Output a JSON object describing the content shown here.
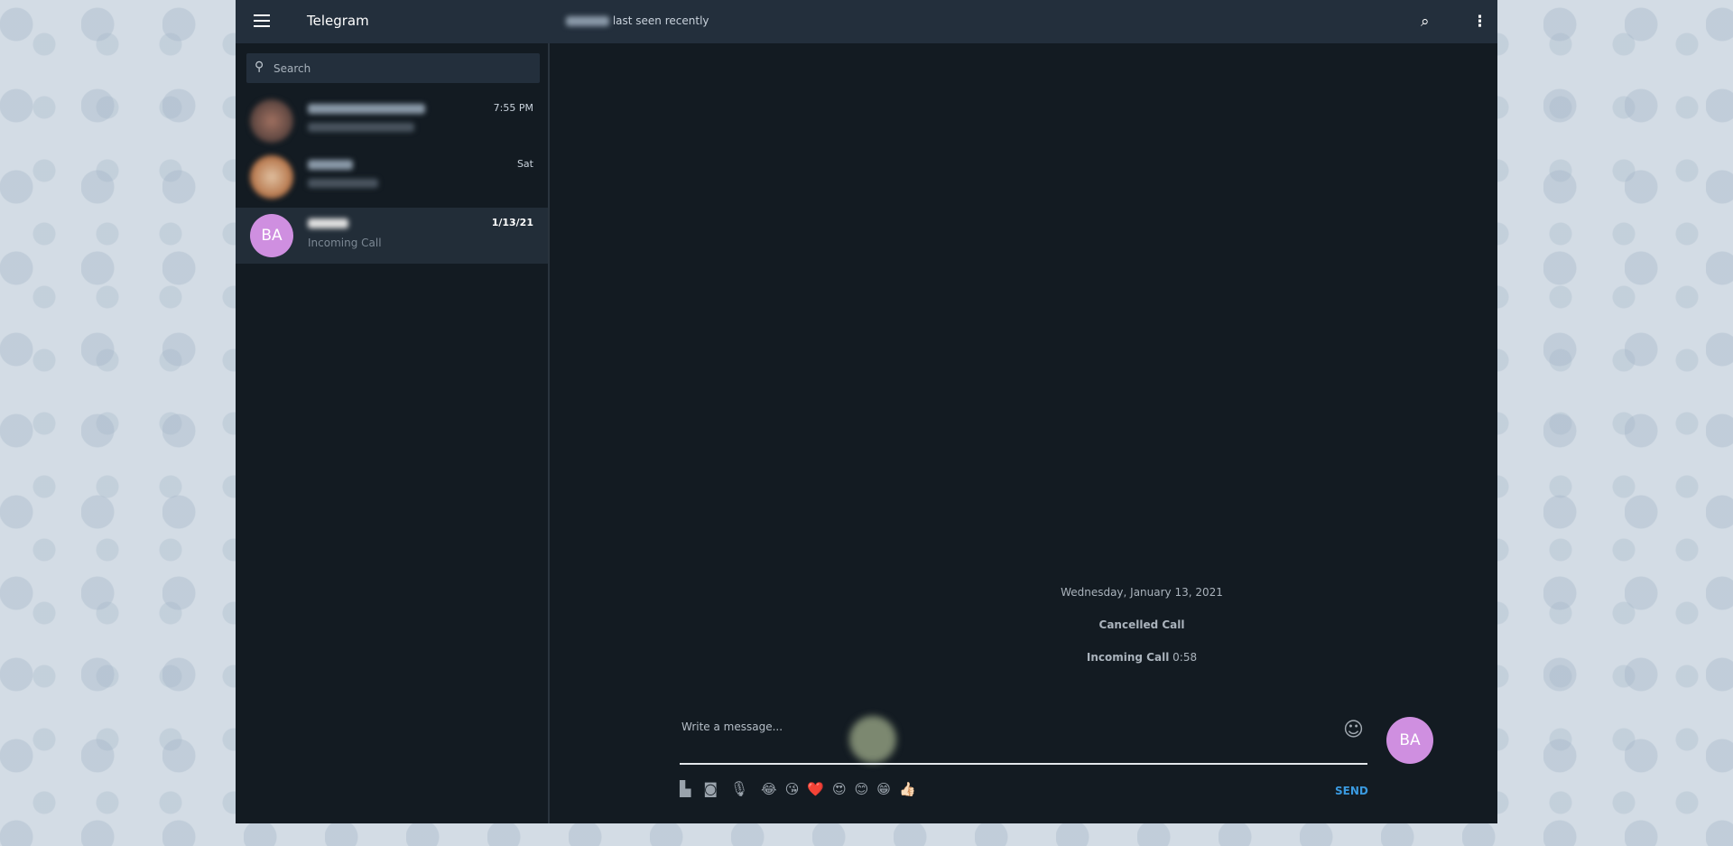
{
  "header": {
    "app_title": "Telegram",
    "contact_status": "last seen recently"
  },
  "search": {
    "placeholder": "Search"
  },
  "chats": [
    {
      "time": "7:55 PM"
    },
    {
      "time": "Sat"
    },
    {
      "initials": "BA",
      "preview": "Incoming Call",
      "time": "1/13/21",
      "avatar_color": "#cf8fe0"
    }
  ],
  "messages": {
    "date": "Wednesday, January 13, 2021",
    "cancelled": "Cancelled Call",
    "incoming": "Incoming Call",
    "incoming_duration": "0:58"
  },
  "composer": {
    "placeholder": "Write a message...",
    "send": "SEND",
    "initials": "BA",
    "emojis": [
      "😂",
      "😘",
      "❤️",
      "😍",
      "😊",
      "😁",
      "👍🏻"
    ]
  },
  "colors": {
    "accent": "#3a9ae0",
    "header": "#232f3c",
    "panel": "#131b22"
  }
}
